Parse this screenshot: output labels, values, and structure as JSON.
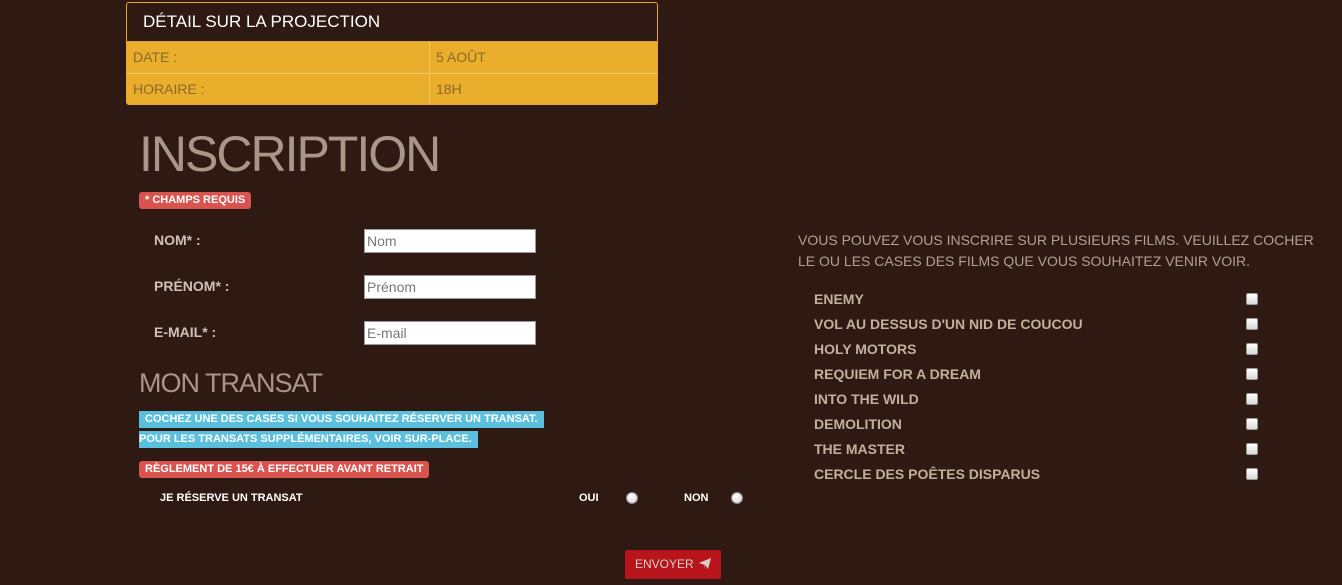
{
  "projection": {
    "title": "DÉTAIL SUR LA PROJECTION",
    "rows": [
      {
        "label": "DATE :",
        "value": "5 AOÛT"
      },
      {
        "label": "HORAIRE :",
        "value": "18H"
      }
    ]
  },
  "inscription": {
    "title": "INSCRIPTION",
    "required_badge": "* CHAMPS REQUIS",
    "fields": [
      {
        "label": "NOM* :",
        "placeholder": "Nom",
        "value": ""
      },
      {
        "label": "PRÉNOM* :",
        "placeholder": "Prénom",
        "value": ""
      },
      {
        "label": "E-MAIL* :",
        "placeholder": "E-mail",
        "value": ""
      }
    ]
  },
  "transat": {
    "title": "MON TRANSAT",
    "info_line_1": "COCHEZ UNE DES CASES SI VOUS SOUHAITEZ RÉSERVER UN TRANSAT.",
    "info_line_2": "POUR LES TRANSATS SUPPLÉMENTAIRES, VOIR SUR-PLACE.",
    "payment_badge": "RÈGLEMENT DE 15€ À EFFECTUER AVANT RETRAIT",
    "question": "JE RÉSERVE UN TRANSAT",
    "option_yes": "OUI",
    "option_no": "NON"
  },
  "films": {
    "intro": "VOUS POUVEZ VOUS INSCRIRE SUR PLUSIEURS FILMS. VEUILLEZ COCHER LE OU LES CASES DES FILMS QUE VOUS SOUHAITEZ VENIR VOIR.",
    "items": [
      "ENEMY",
      "VOL AU DESSUS D'UN NID DE COUCOU",
      "HOLY MOTORS",
      "REQUIEM FOR A DREAM",
      "INTO THE WILD",
      "DEMOLITION",
      "THE MASTER",
      "CERCLE DES POÊTES DISPARUS"
    ]
  },
  "submit": {
    "label": "ENVOYER",
    "icon": "paper-plane-icon"
  },
  "colors": {
    "background": "#2e1a13",
    "panel": "#e9ae2c",
    "danger": "#d9534f",
    "info": "#5bc0de",
    "submit": "#b7151b"
  }
}
